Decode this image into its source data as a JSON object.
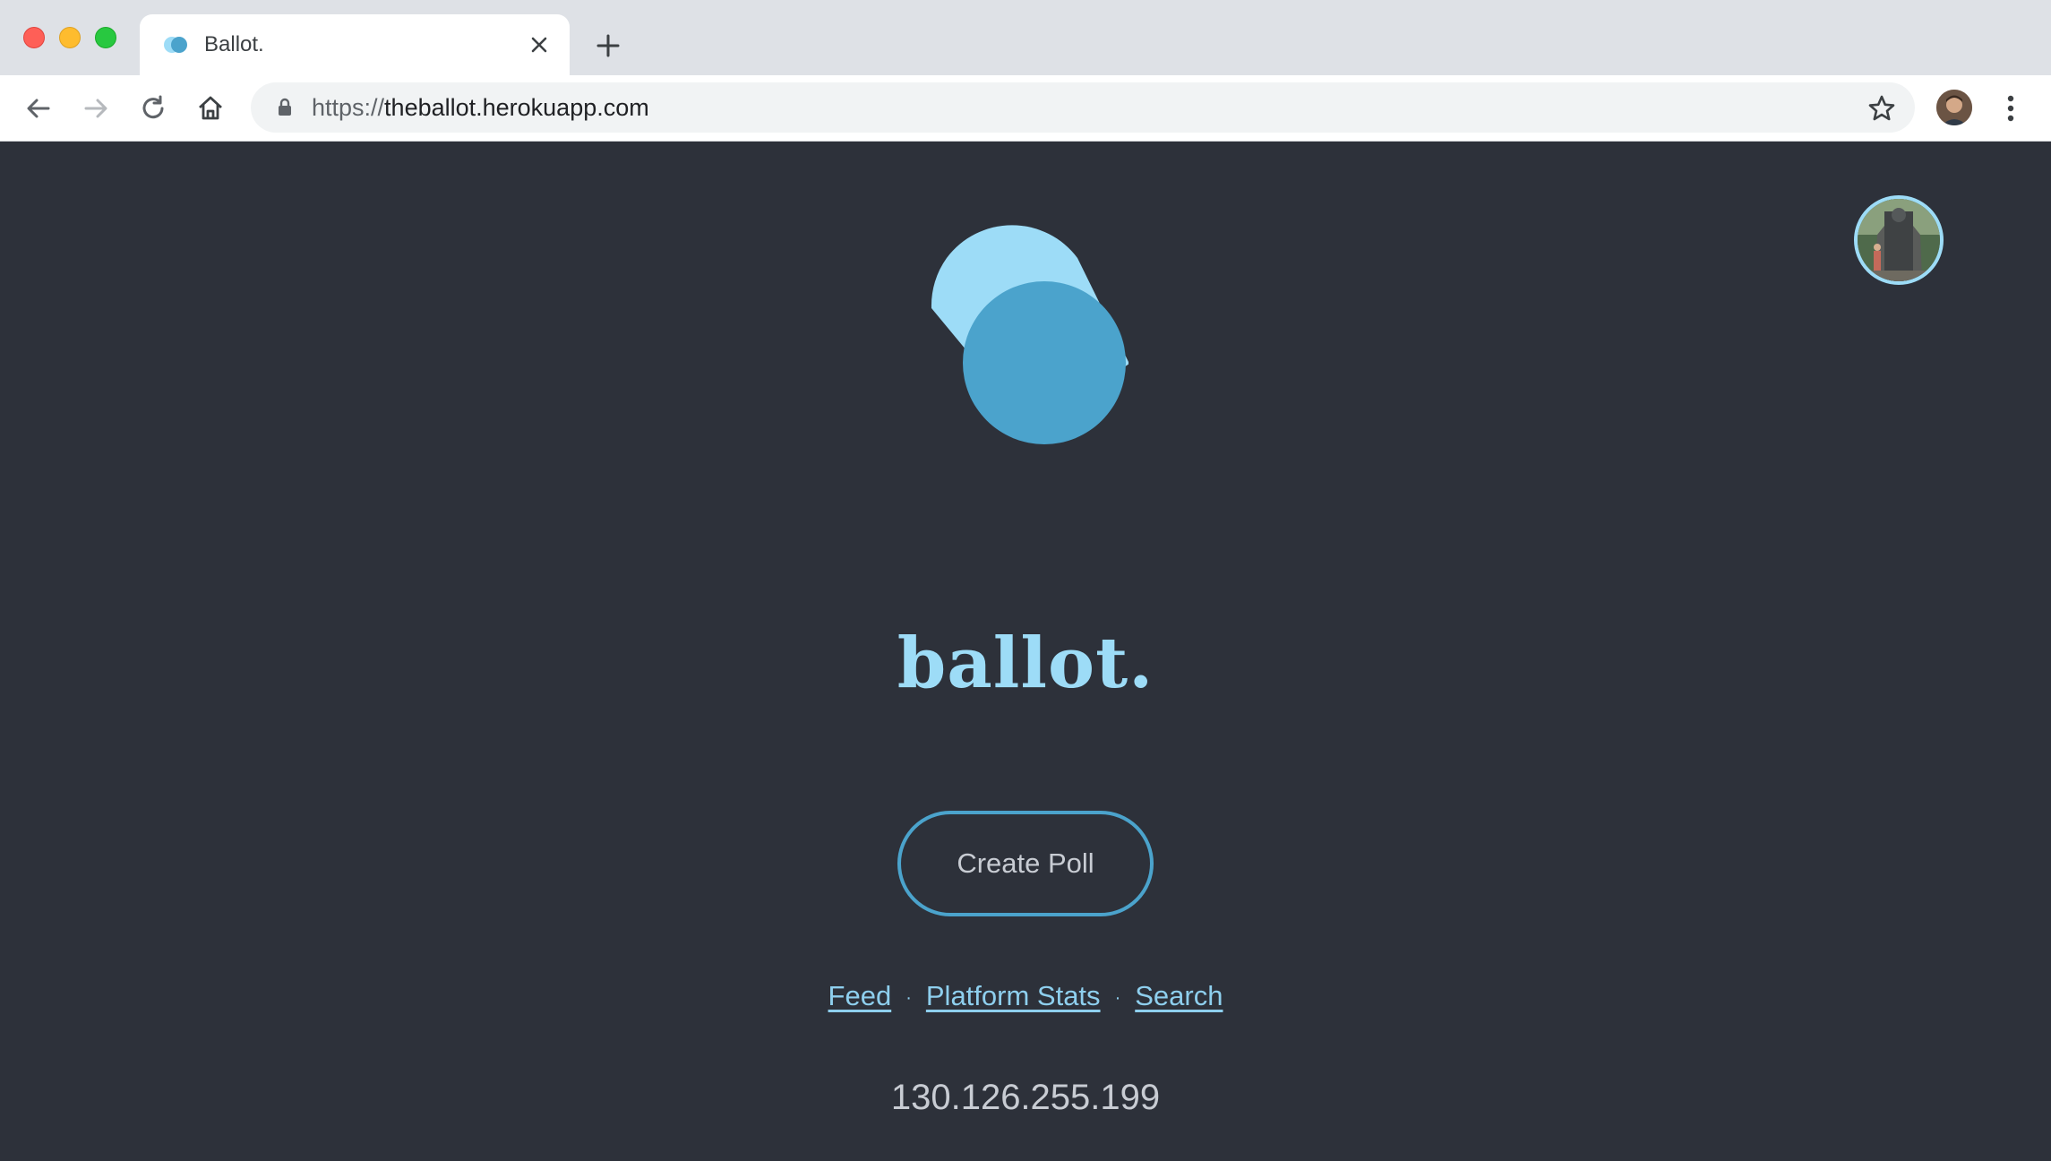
{
  "browser": {
    "tab": {
      "title": "Ballot."
    },
    "address_bar": {
      "scheme": "https://",
      "host": "theballot.herokuapp.com"
    }
  },
  "page": {
    "brand": "ballot.",
    "create_button_label": "Create Poll",
    "links": {
      "feed": "Feed",
      "separator": "·",
      "platform_stats": "Platform Stats",
      "search": "Search"
    },
    "ip_address": "130.126.255.199"
  },
  "colors": {
    "background": "#2d313a",
    "accent_light": "#9ddcf7",
    "accent_dark": "#4ba3cc",
    "text_muted": "#c8ccd3"
  }
}
